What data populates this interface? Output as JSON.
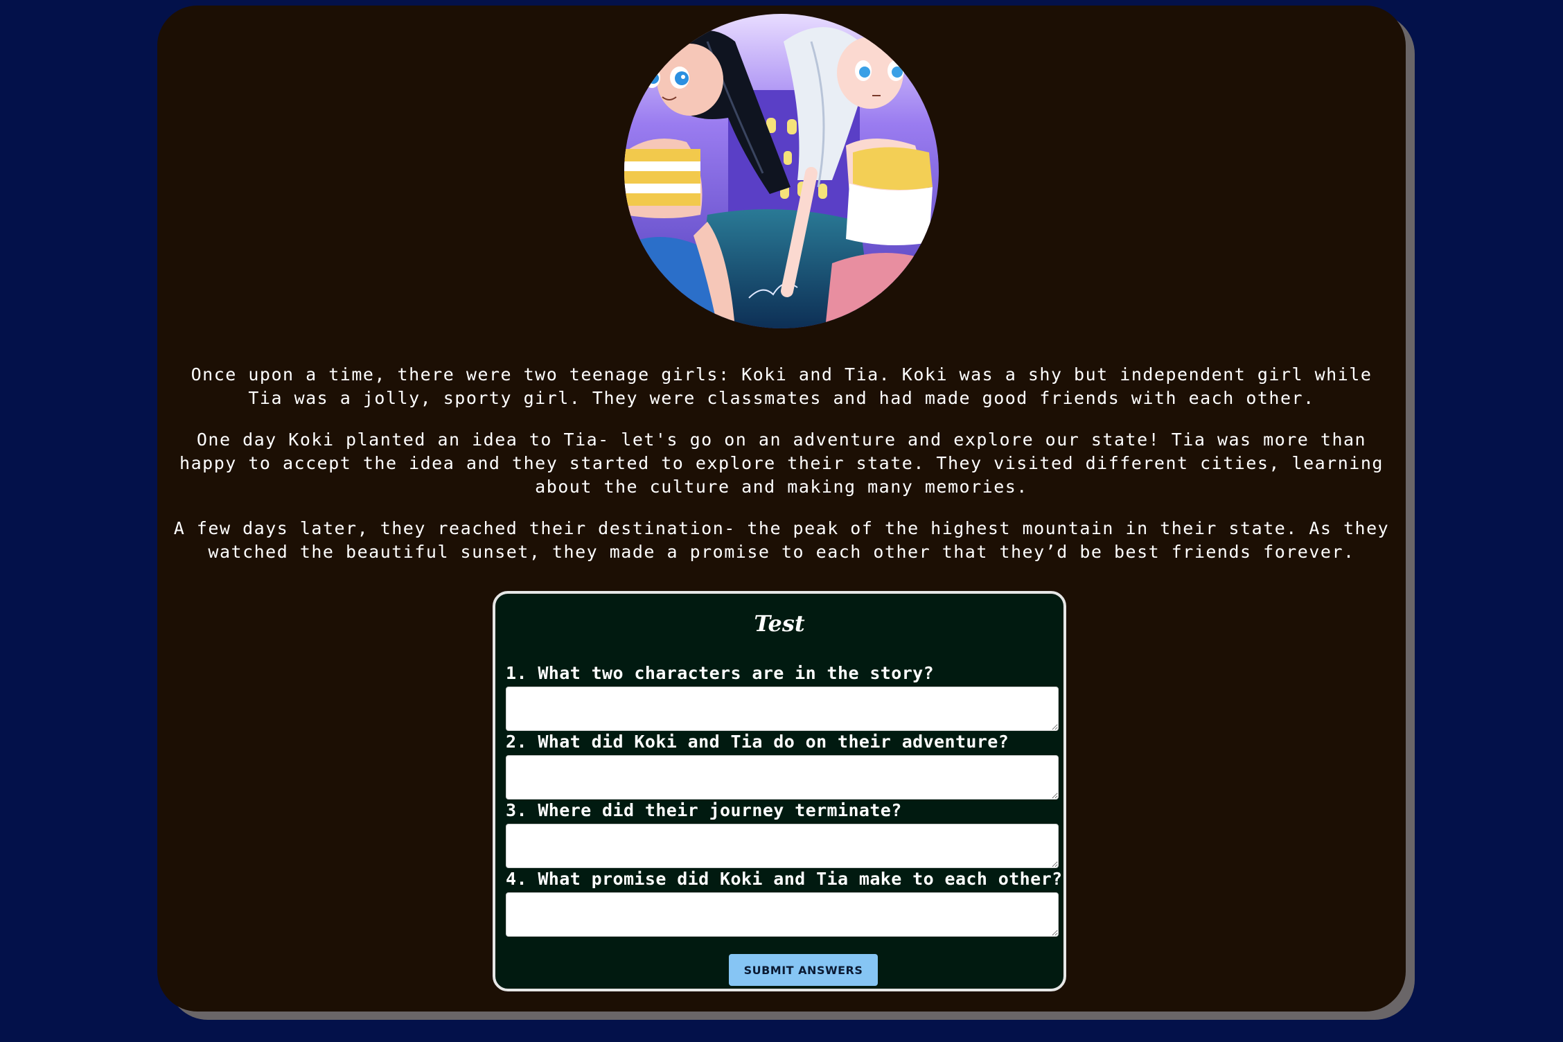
{
  "story": {
    "paragraphs": [
      "Once upon a time, there were two teenage girls: Koki and Tia. Koki was a shy but independent girl while Tia was a jolly, sporty girl. They were classmates and had made good friends with each other.",
      "One day Koki planted an idea to Tia- let's go on an adventure and explore our state! Tia was more than happy to accept the idea and they started to explore their state. They visited different cities, learning about the culture and making many memories.",
      "A few days later, they reached their destination- the peak of the highest mountain in their state. As they watched the beautiful sunset, they made a promise to each other that they’d be best friends forever."
    ]
  },
  "test": {
    "title": "Test",
    "questions": [
      {
        "label": "1. What two characters are in the story?",
        "value": ""
      },
      {
        "label": "2. What did Koki and Tia do on their adventure?",
        "value": ""
      },
      {
        "label": "3. Where did their journey terminate?",
        "value": ""
      },
      {
        "label": "4. What promise did Koki and Tia make to each other?",
        "value": ""
      }
    ],
    "submit_label": "SUBMIT ANSWERS"
  },
  "colors": {
    "page_background": "#03114a",
    "card_background": "#1c0f04",
    "card_shadow": "#6a6668",
    "test_background": "#011a10",
    "test_border": "#e6e6e6",
    "submit_button": "#86c5f4"
  },
  "illustration": {
    "subject": "two anime-style girls in front of a purple night sky and lit building"
  }
}
